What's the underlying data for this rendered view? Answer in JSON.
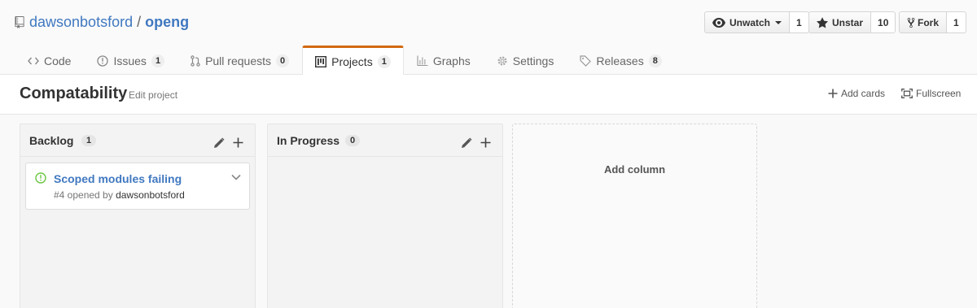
{
  "repo": {
    "owner": "dawsonbotsford",
    "separator": "/",
    "name": "openg"
  },
  "actions": {
    "watch": {
      "label": "Unwatch",
      "count": "1"
    },
    "star": {
      "label": "Unstar",
      "count": "10"
    },
    "fork": {
      "label": "Fork",
      "count": "1"
    }
  },
  "tabs": [
    {
      "label": "Code",
      "icon": "code-icon"
    },
    {
      "label": "Issues",
      "count": "1",
      "icon": "issue-opened-icon"
    },
    {
      "label": "Pull requests",
      "count": "0",
      "icon": "git-pull-request-icon"
    },
    {
      "label": "Projects",
      "count": "1",
      "icon": "project-icon",
      "selected": true
    },
    {
      "label": "Graphs",
      "icon": "graph-icon"
    },
    {
      "label": "Settings",
      "icon": "gear-icon"
    },
    {
      "label": "Releases",
      "count": "8",
      "icon": "tag-icon"
    }
  ],
  "project": {
    "title": "Compatability",
    "edit_label": "Edit project",
    "add_cards_label": "Add cards",
    "fullscreen_label": "Fullscreen"
  },
  "columns": [
    {
      "name": "Backlog",
      "count": "1",
      "cards": [
        {
          "title": "Scoped modules failing",
          "meta_prefix": "#4 opened by",
          "user": "dawsonbotsford"
        }
      ]
    },
    {
      "name": "In Progress",
      "count": "0",
      "cards": []
    }
  ],
  "add_column_label": "Add column",
  "colors": {
    "link": "#4078c0",
    "selected_tab_accent": "#d26911",
    "open_issue_green": "#6cc644"
  }
}
